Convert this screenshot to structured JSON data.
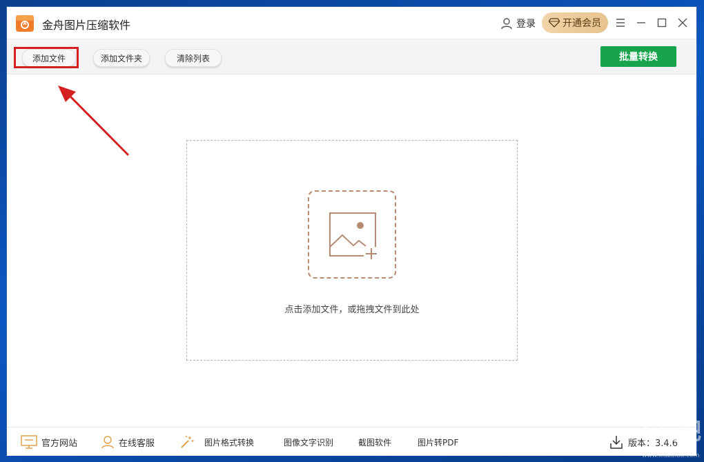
{
  "app": {
    "title": "金舟图片压缩软件"
  },
  "header": {
    "login_label": "登录",
    "vip_label": "开通会员"
  },
  "toolbar": {
    "add_file_label": "添加文件",
    "add_folder_label": "添加文件夹",
    "clear_list_label": "清除列表",
    "batch_convert_label": "批量转换"
  },
  "dropzone": {
    "hint": "点击添加文件，或拖拽文件到此处"
  },
  "footer": {
    "official_site": "官方网站",
    "online_service": "在线客服",
    "format_convert": "图片格式转换",
    "ocr": "图像文字识别",
    "screenshot": "截图软件",
    "to_pdf": "图片转PDF",
    "version": "版本：3.4.6"
  },
  "watermark": {
    "text": "下载吧",
    "sub": "www.xiazaiba.com"
  },
  "colors": {
    "accent_green": "#17a44a",
    "vip_gold": "#e8c48e",
    "annotation_red": "#d42020",
    "dropzone_icon": "#b98a72"
  },
  "icons": [
    "app-logo",
    "user-icon",
    "diamond-icon",
    "menu-icon",
    "minimize-icon",
    "maximize-icon",
    "close-icon",
    "image-add-icon",
    "monitor-icon",
    "headset-icon",
    "magic-wand-icon",
    "download-icon"
  ]
}
